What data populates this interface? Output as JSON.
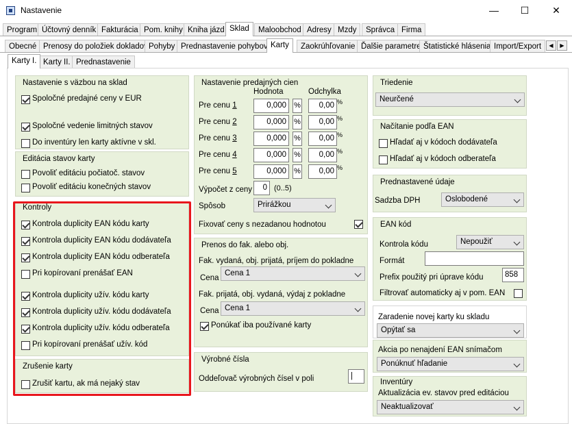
{
  "window": {
    "title": "Nastavenie",
    "minimize": "—",
    "maximize": "☐",
    "close": "✕"
  },
  "tabs1": [
    "Program",
    "Účtovný denník",
    "Fakturácia",
    "Pom. knihy",
    "Kniha jázd",
    "Sklad",
    "Maloobchod",
    "Adresy",
    "Mzdy",
    "Správca",
    "Firma"
  ],
  "tabs2": [
    "Obecné",
    "Prenosy do položiek dokladov",
    "Pohyby",
    "Prednastavenie pohybov",
    "Karty",
    "Zaokrúhľovanie",
    "Ďalšie parametre",
    "Štatistické hlásenia",
    "Import/Export"
  ],
  "tabs3": [
    "Karty I.",
    "Karty II.",
    "Prednastavenie"
  ],
  "scroll": {
    "left": "◀",
    "right": "▶"
  },
  "g1": {
    "title": "Nastavenie s väzbou na sklad",
    "items": [
      "Spoločné predajné ceny v EUR",
      "Spoločné vedenie limitných stavov",
      "Do inventúry len karty aktívne v skl."
    ]
  },
  "g2": {
    "title": "Editácia stavov karty",
    "items": [
      "Povoliť editáciu počiatoč. stavov",
      "Povoliť editáciu konečných stavov"
    ]
  },
  "g3": {
    "title": "Kontroly",
    "items": [
      "Kontrola duplicity EAN kódu karty",
      "Kontrola duplicity EAN kódu dodávateľa",
      "Kontrola duplicity EAN kódu odberateľa",
      "Pri kopírovaní prenášať EAN",
      "Kontrola duplicity užív. kódu karty",
      "Kontrola duplicity užív. kódu dodávateľa",
      "Kontrola duplicity užív. kódu odberateľa",
      "Pri kopírovaní prenášať užív. kód"
    ]
  },
  "g4": {
    "title": "Zrušenie karty",
    "items": [
      "Zrušiť kartu, ak má nejaký stav"
    ]
  },
  "prices": {
    "title": "Nastavenie predajných cien",
    "col_value": "Hodnota",
    "col_dev": "Odchylka",
    "rows": [
      {
        "label": "Pre cenu ",
        "num": "1",
        "value": "0,000",
        "pct": "%",
        "dev": "0,00",
        "dev_pct": "%"
      },
      {
        "label": "Pre cenu ",
        "num": "2",
        "value": "0,000",
        "pct": "%",
        "dev": "0,00",
        "dev_pct": "%"
      },
      {
        "label": "Pre cenu ",
        "num": "3",
        "value": "0,000",
        "pct": "%",
        "dev": "0,00",
        "dev_pct": "%"
      },
      {
        "label": "Pre cenu ",
        "num": "4",
        "value": "0,000",
        "pct": "%",
        "dev": "0,00",
        "dev_pct": "%"
      },
      {
        "label": "Pre cenu ",
        "num": "5",
        "value": "0,000",
        "pct": "%",
        "dev": "0,00",
        "dev_pct": "%"
      }
    ],
    "calc_label": "Výpočet z ceny",
    "calc_value": "0",
    "calc_range": "(0..5)",
    "method_label": "Spôsob",
    "method_value": "Prirážkou",
    "fix_label": "Fixovať ceny s nezadanou hodnotou"
  },
  "transfer": {
    "title": "Prenos do fak. alebo obj.",
    "line1": "Fak. vydaná, obj. prijatá, príjem do pokladne",
    "cena_label": "Cena",
    "cena1": "Cena 1",
    "line2": "Fak. prijatá, obj. vydaná, výdaj z pokladne",
    "cena2": "Cena 1",
    "offer": "Ponúkať iba používané karty"
  },
  "serial": {
    "title": "Výrobné čísla",
    "label": "Oddeľovač výrobných čísel v poli",
    "value": "|"
  },
  "sort": {
    "title": "Triedenie",
    "value": "Neurčené"
  },
  "ean_load": {
    "title": "Načítanie podľa EAN",
    "items": [
      "Hľadať aj v kódoch dodávateľa",
      "Hľadať aj v kódoch odberateľa"
    ]
  },
  "preset": {
    "title": "Prednastavené údaje",
    "vat_label": "Sadzba DPH",
    "vat_value": "Oslobodené"
  },
  "ean_code": {
    "title": "EAN kód",
    "check_label": "Kontrola kódu",
    "check_value": "Nepoužiť",
    "format_label": "Formát",
    "format_value": "",
    "prefix_label": "Prefix použitý pri úprave kódu",
    "prefix_value": "858",
    "filter_label": "Filtrovať automaticky aj v pom. EAN"
  },
  "assign": {
    "title": "Zaradenie novej karty ku skladu",
    "value": "Opýtať sa"
  },
  "action": {
    "title": "Akcia po nenajdení EAN snímačom",
    "value": "Ponúknuť hľadanie"
  },
  "inventory": {
    "title": "Inventúry",
    "label": "Aktualizácia ev. stavov pred editáciou",
    "value": "Neaktualizovať"
  }
}
